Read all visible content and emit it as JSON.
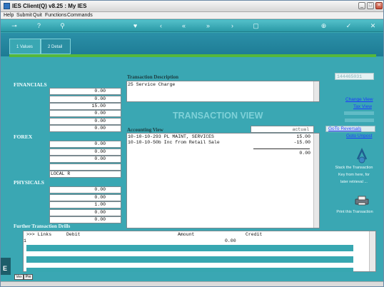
{
  "window": {
    "title": "IES Client(Q) v8.25 : My IES",
    "buttons": [
      "_",
      "□",
      "×"
    ]
  },
  "menu": [
    "Help",
    "Submit",
    "Quit",
    "Functions",
    "Commands"
  ],
  "toolbar": [
    "key-icon",
    "help-icon",
    "search-icon",
    "heart-icon",
    "prev-icon",
    "first-icon",
    "last-icon",
    "next-icon",
    "filter-icon",
    "new-icon",
    "print-icon",
    "ok-icon",
    "close-icon"
  ],
  "tabs": [
    {
      "label": "1 Values",
      "active": true
    },
    {
      "label": "2 Detail",
      "active": false
    }
  ],
  "financials": {
    "title": "FINANCIALS",
    "values": [
      "0.00",
      "0.00",
      "15.00",
      "0.00",
      "0.00",
      "0.00"
    ]
  },
  "forex": {
    "title": "FOREX",
    "values": [
      "0.00",
      "0.00",
      "0.00",
      "",
      "LOCAL R"
    ]
  },
  "physicals": {
    "title": "PHYSICALS",
    "values": [
      "0.00",
      "0.00",
      "1.00",
      "0.00",
      "0.00"
    ]
  },
  "transaction": {
    "description_label": "Transaction Description",
    "description": "25 Service Charge",
    "view_title": "TRANSACTION VIEW",
    "ref_value": "144465031",
    "accounting_label": "Accounting View",
    "accounting_mode": "actual",
    "lines": [
      {
        "account": "10-10-10-293 PL MAINT, SERVICES",
        "amount": "15.00"
      },
      {
        "account": "10-10-10-50b Inc from Retail Sale",
        "amount": "-15.00"
      }
    ],
    "total": "0.00"
  },
  "links": {
    "change_view": "Change View",
    "tax_view": "Tax View",
    "goto_reversals": "GoTo Reversals",
    "goto_unpost": "Goto Unpost"
  },
  "notes": {
    "stack": [
      "Stack the Transaction",
      "Key from here, for",
      "later retrieval ..."
    ],
    "print": "Print this Transaction"
  },
  "drills": {
    "title": "Further Transaction Drills",
    "headers": [
      ">>> Links",
      "Debit",
      "Amount",
      "Credit"
    ],
    "rows": [
      {
        "num": "1",
        "amount": "0.00"
      }
    ]
  },
  "bottom_tabs": [
    "Vex",
    "Pre"
  ],
  "colors": {
    "panel": "#3aa7b3",
    "accent_green": "#55b83b",
    "link": "#1e38ff"
  }
}
